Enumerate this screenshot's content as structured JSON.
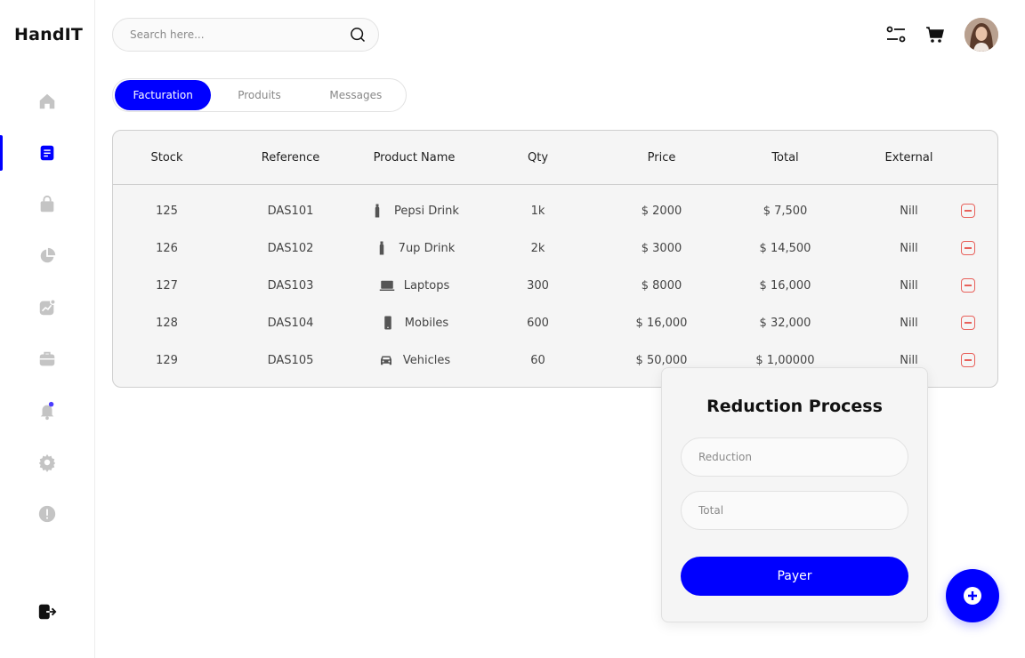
{
  "app": {
    "logo": "HandIT"
  },
  "colors": {
    "accent": "#0000ff",
    "danger": "#e8615b",
    "muted_icon": "#c4c4c4"
  },
  "sidebar": {
    "items": [
      {
        "icon": "home-icon",
        "active": false
      },
      {
        "icon": "document-icon",
        "active": true
      },
      {
        "icon": "bag-icon",
        "active": false
      },
      {
        "icon": "pie-chart-icon",
        "active": false
      },
      {
        "icon": "trend-chart-icon",
        "active": false
      },
      {
        "icon": "briefcase-icon",
        "active": false
      },
      {
        "icon": "bell-icon",
        "active": false
      },
      {
        "icon": "settings-icon",
        "active": false
      },
      {
        "icon": "alert-icon",
        "active": false
      }
    ],
    "logout_icon": "logout-icon"
  },
  "search": {
    "placeholder": "Search here...",
    "value": ""
  },
  "header": {
    "icons": [
      "filter-icon",
      "cart-icon"
    ],
    "avatar": "user-avatar"
  },
  "tabs": [
    {
      "label": "Facturation",
      "active": true
    },
    {
      "label": "Produits",
      "active": false
    },
    {
      "label": "Messages",
      "active": false
    }
  ],
  "table": {
    "headers": [
      "Stock",
      "Reference",
      "Product Name",
      "Qty",
      "Price",
      "Total",
      "External"
    ],
    "rows": [
      {
        "stock": "125",
        "reference": "DAS101",
        "icon": "bottle-icon",
        "product": "Pepsi Drink",
        "qty": "1k",
        "price": "$ 2000",
        "total": "$ 7,500",
        "external": "Nill"
      },
      {
        "stock": "126",
        "reference": "DAS102",
        "icon": "bottle-icon",
        "product": "7up Drink",
        "qty": "2k",
        "price": "$ 3000",
        "total": "$ 14,500",
        "external": "Nill"
      },
      {
        "stock": "127",
        "reference": "DAS103",
        "icon": "laptop-icon",
        "product": "Laptops",
        "qty": "300",
        "price": "$ 8000",
        "total": "$ 16,000",
        "external": "Nill"
      },
      {
        "stock": "128",
        "reference": "DAS104",
        "icon": "mobile-icon",
        "product": "Mobiles",
        "qty": "600",
        "price": "$ 16,000",
        "total": "$ 32,000",
        "external": "Nill"
      },
      {
        "stock": "129",
        "reference": "DAS105",
        "icon": "car-icon",
        "product": "Vehicles",
        "qty": "60",
        "price": "$ 50,000",
        "total": "$ 1,00000",
        "external": "Nill"
      }
    ]
  },
  "modal": {
    "title": "Reduction Process",
    "reduction_placeholder": "Reduction",
    "total_placeholder": "Total",
    "pay_label": "Payer"
  },
  "fab": {
    "icon": "plus-circle-icon"
  }
}
